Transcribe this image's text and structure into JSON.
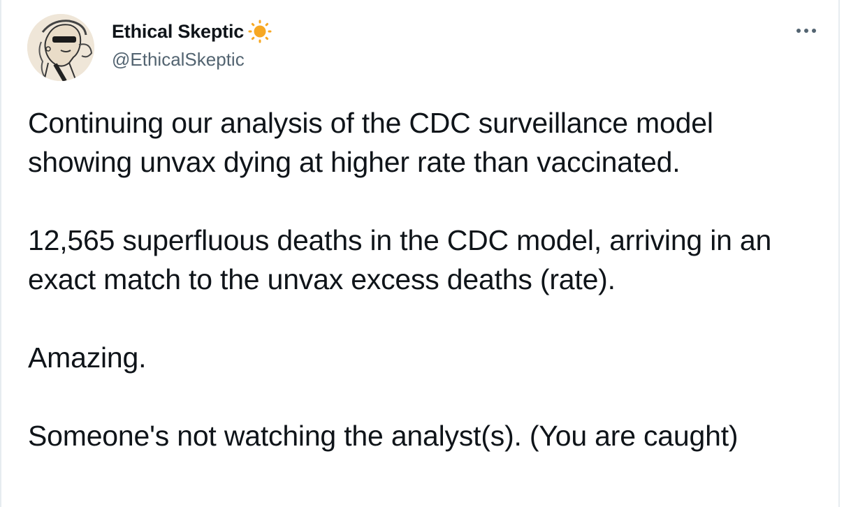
{
  "tweet": {
    "author": {
      "display_name": "Ethical Skeptic",
      "badge_icon": "sun-icon",
      "handle": "@EthicalSkeptic",
      "avatar_icon": "avatar-sketch-icon"
    },
    "more_icon": "more-horizontal-icon",
    "paragraphs": [
      "Continuing our analysis of the CDC surveillance model showing unvax dying at higher rate than vaccinated.",
      "12,565 superfluous deaths in the CDC model, arriving in an exact match to the unvax excess deaths (rate).",
      "Amazing.",
      "Someone's not watching the analyst(s). (You are caught)"
    ]
  },
  "colors": {
    "text": "#0f1419",
    "secondary": "#536471",
    "sun": "#f7a823",
    "border": "#e6ecf0"
  }
}
